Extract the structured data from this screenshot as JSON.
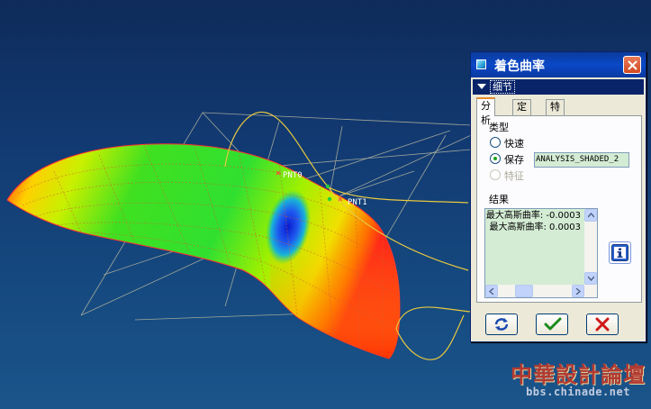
{
  "viewport": {
    "background_top": "#0e2b5a",
    "background_bottom": "#1a558a",
    "points": [
      {
        "label": "PNT0"
      },
      {
        "label": "PNT1"
      }
    ]
  },
  "dialog": {
    "title": "着色曲率",
    "title_icon": "surface-icon",
    "close_icon": "close-icon",
    "section_label": "细节",
    "tabs": [
      "分析",
      "定义",
      "特征"
    ],
    "active_tab": "分析",
    "type_group": {
      "label": "类型",
      "options": [
        {
          "label": "快速",
          "checked": false,
          "enabled": true
        },
        {
          "label": "保存",
          "checked": true,
          "enabled": true
        },
        {
          "label": "特征",
          "checked": false,
          "enabled": false
        }
      ],
      "name_value": "ANALYSIS_SHADED_2"
    },
    "results": {
      "label": "结果",
      "lines": [
        "最大高斯曲率: -0.0003",
        "最大高斯曲率: 0.0003"
      ]
    },
    "info_icon": "info-icon",
    "buttons": {
      "compute_icon": "refresh-icon",
      "ok_icon": "checkmark-icon",
      "cancel_icon": "cancel-x-icon"
    }
  },
  "watermark": {
    "chinese": "中華設計論壇",
    "url": "bbs.chinade.net"
  }
}
